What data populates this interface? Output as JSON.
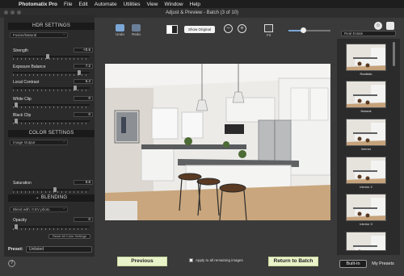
{
  "menubar": {
    "app_name": "Photomatix Pro",
    "items": [
      "File",
      "Edit",
      "Automate",
      "Utilities",
      "View",
      "Window",
      "Help"
    ]
  },
  "window": {
    "title": "Adjust & Preview - Batch (3 of 10)"
  },
  "toolbar": {
    "undo": "Undo",
    "redo": "Redo",
    "show_original": "Show Original",
    "fit": "Fit",
    "preview_size_level": 0.35
  },
  "hdr": {
    "section_title": "HDR SETTINGS",
    "method": "Fusion/Natural",
    "sliders": [
      {
        "label": "Strength",
        "value": "<0.6",
        "level": 0.45
      },
      {
        "label": "Exposure Balance",
        "value": "7.2",
        "level": 0.88
      },
      {
        "label": "Local Contrast",
        "value": "6.4",
        "level": 0.82
      },
      {
        "label": "White Clip",
        "value": "0",
        "level": 0.02
      },
      {
        "label": "Black Clip",
        "value": "0",
        "level": 0.02
      }
    ]
  },
  "color": {
    "section_title": "COLOR SETTINGS",
    "mode": "Image Output",
    "saturation_label": "Saturation",
    "saturation_value": "0.8",
    "saturation_level": 0.55
  },
  "blending": {
    "section_title": "BLENDING",
    "mode": "Blend with: 0 EV photo",
    "opacity_label": "Opacity",
    "opacity_value": "0",
    "opacity_level": 0.02,
    "reset_label": "Reset All Color Settings"
  },
  "preset": {
    "label": "Preset:",
    "value": "Unlisted"
  },
  "help": "?",
  "bottom": {
    "previous": "Previous",
    "apply_all": "Apply to all remaining images",
    "return": "Return to Batch"
  },
  "right_panel": {
    "category": "Real Estate",
    "presets": [
      "Realistic",
      "Natural",
      "Interior",
      "Interior 2",
      "Interior 3",
      ""
    ],
    "tab_builtin": "Built-In",
    "tab_my": "My Presets"
  },
  "colors": {
    "accent_green_button": "#e9f3c9",
    "panel_dark": "#2b2b2b",
    "window_bg": "#3a3a3a",
    "slider_blue": "#7ba7d6"
  }
}
